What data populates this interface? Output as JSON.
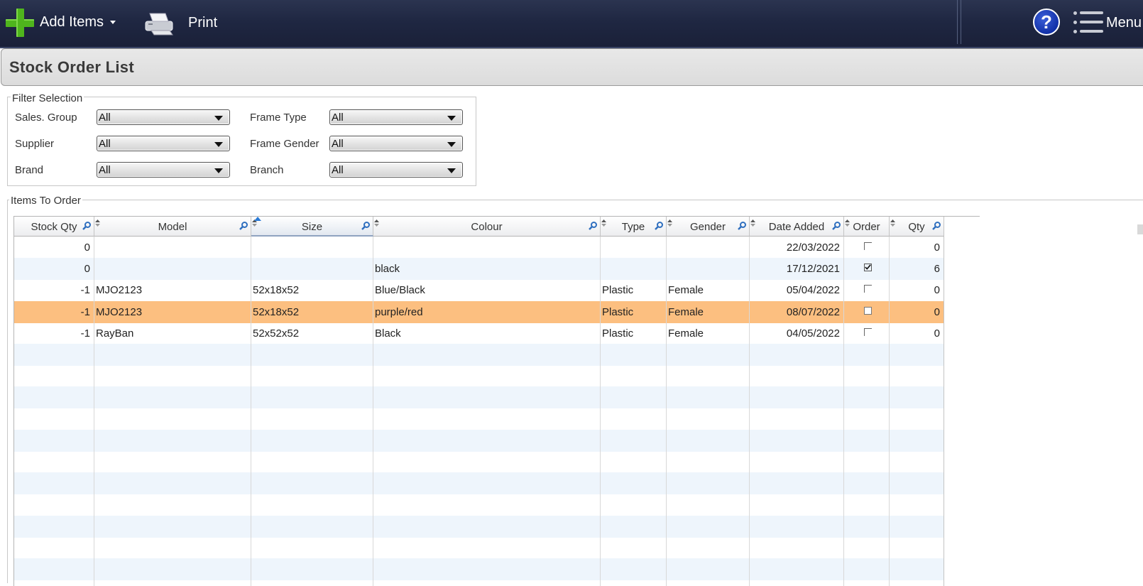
{
  "toolbar": {
    "add_items_label": "Add Items",
    "print_label": "Print",
    "menu_label": "Menu",
    "help_glyph": "?"
  },
  "page": {
    "title": "Stock Order List"
  },
  "filters": {
    "legend": "Filter Selection",
    "sales_group": {
      "label": "Sales. Group",
      "value": "All"
    },
    "supplier": {
      "label": "Supplier",
      "value": "All"
    },
    "brand": {
      "label": "Brand",
      "value": "All"
    },
    "frame_type": {
      "label": "Frame Type",
      "value": "All"
    },
    "frame_gender": {
      "label": "Frame Gender",
      "value": "All"
    },
    "branch": {
      "label": "Branch",
      "value": "All"
    }
  },
  "items": {
    "legend": "Items To Order",
    "columns": [
      "Stock Qty",
      "Model",
      "Size",
      "Colour",
      "Type",
      "Gender",
      "Date Added",
      "Order",
      "Qty"
    ],
    "sorted_column": "Size",
    "rows": [
      {
        "stock_qty": "0",
        "model": "",
        "size": "",
        "colour": "",
        "type": "",
        "gender": "",
        "date_added": "22/03/2022",
        "order": false,
        "qty": "0"
      },
      {
        "stock_qty": "0",
        "model": "",
        "size": "",
        "colour": "black",
        "type": "",
        "gender": "",
        "date_added": "17/12/2021",
        "order": true,
        "qty": "6"
      },
      {
        "stock_qty": "-1",
        "model": "MJO2123",
        "size": "52x18x52",
        "colour": "Blue/Black",
        "type": "Plastic",
        "gender": "Female",
        "date_added": "05/04/2022",
        "order": false,
        "qty": "0"
      },
      {
        "stock_qty": "-1",
        "model": "MJO2123",
        "size": "52x18x52",
        "colour": "purple/red",
        "type": "Plastic",
        "gender": "Female",
        "date_added": "08/07/2022",
        "order": false,
        "qty": "0",
        "selected": true
      },
      {
        "stock_qty": "-1",
        "model": "RayBan",
        "size": "52x52x52",
        "colour": "Black",
        "type": "Plastic",
        "gender": "Female",
        "date_added": "04/05/2022",
        "order": false,
        "qty": "0"
      }
    ],
    "selected_row_color": "#fcbf80",
    "alt_row_color": "#eef5fc"
  }
}
